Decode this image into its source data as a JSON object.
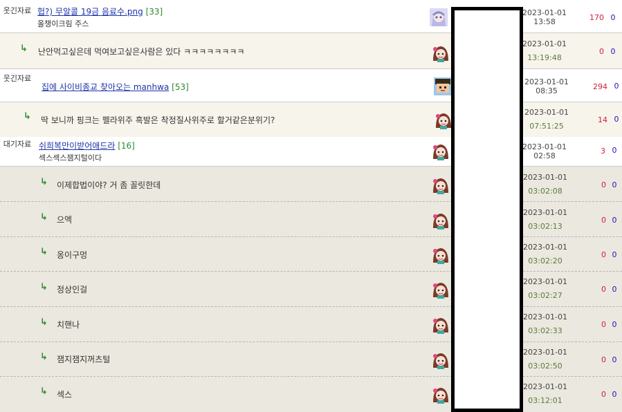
{
  "posts": [
    {
      "category": "웃긴자료",
      "title": "헙?) 무알콜 19금 음료수.png",
      "comments": "[33]",
      "subtitle": "올챙이크림 주스",
      "date": "2023-01-01",
      "time": "13:58",
      "views": "170",
      "votes": "0"
    },
    {
      "reply": "난안먹고싶은데 먹여보고싶은사람은 있다 ㅋㅋㅋㅋㅋㅋㅋㅋ",
      "date": "2023-01-01",
      "time": "13:19:48",
      "views": "0",
      "votes": "0"
    },
    {
      "category": "웃긴자료",
      "title": "집에 사이비종교 찾아오는 manhwa",
      "comments": "[53]",
      "date": "2023-01-01",
      "time": "08:35",
      "views": "294",
      "votes": "0"
    },
    {
      "reply": "딱 보니까 핑크는 펠라위주 흑발은 착정질사위주로 할거같은분위기?",
      "date": "2023-01-01",
      "time": "07:51:25",
      "views": "14",
      "votes": "0"
    },
    {
      "category": "대기자료",
      "title": "쉬희복만이받어애드라",
      "comments": "[16]",
      "subtitle": "섹스섹스잼지털이다",
      "date": "2023-01-01",
      "time": "02:58",
      "views": "3",
      "votes": "0"
    },
    {
      "reply": "이제합법이야? 거 좀 꼴릿한데",
      "date": "2023-01-01",
      "time": "03:02:08",
      "views": "0",
      "votes": "0"
    },
    {
      "reply": "으엑",
      "date": "2023-01-01",
      "time": "03:02:13",
      "views": "0",
      "votes": "0"
    },
    {
      "reply": "옹이구멍",
      "date": "2023-01-01",
      "time": "03:02:20",
      "views": "0",
      "votes": "0"
    },
    {
      "reply": "정상인걸",
      "date": "2023-01-01",
      "time": "03:02:27",
      "views": "0",
      "votes": "0"
    },
    {
      "reply": "치핸나",
      "date": "2023-01-01",
      "time": "03:02:33",
      "views": "0",
      "votes": "0"
    },
    {
      "reply": "잼지잼지꺼츠털",
      "date": "2023-01-01",
      "time": "03:02:50",
      "views": "0",
      "votes": "0"
    },
    {
      "reply": "섹스",
      "date": "2023-01-01",
      "time": "03:12:01",
      "views": "0",
      "votes": "0"
    }
  ],
  "reply_icon": "reply-arrow-icon",
  "colors": {
    "link": "#1d33a8",
    "comment_count": "#2a8a2a",
    "views": "#d11c3a",
    "votes": "#1a1aa8",
    "reply_bg": "#ebe8df"
  }
}
